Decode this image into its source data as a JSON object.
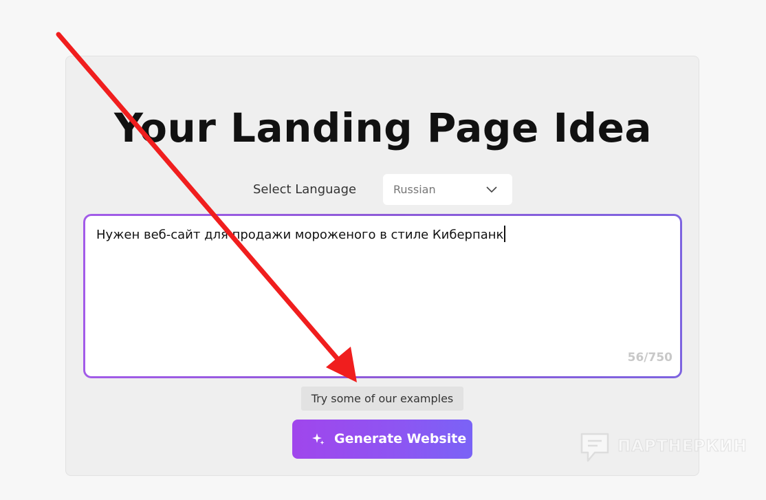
{
  "header": {
    "title": "Your Landing Page Idea"
  },
  "language": {
    "label": "Select Language",
    "selected": "Russian",
    "chevron_icon": "chevron-down-icon"
  },
  "idea": {
    "value": "Нужен веб-сайт для продажи мороженого в стиле Киберпанк",
    "counter": "56/750"
  },
  "actions": {
    "examples_label": "Try some of our examples",
    "generate_label": "Generate Website",
    "generate_icon": "sparkle-icon"
  },
  "watermark": {
    "text": "ПАРТНЕРКИН"
  },
  "colors": {
    "accent_start": "#a046ec",
    "accent_end": "#7a63f6",
    "annotation_arrow": "#f01e1e"
  }
}
